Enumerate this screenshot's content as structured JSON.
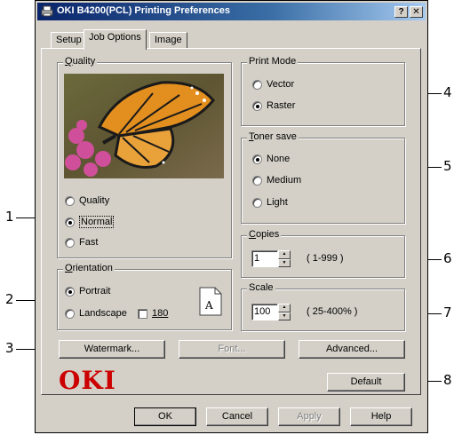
{
  "window": {
    "title": "OKI B4200(PCL) Printing Preferences",
    "help_btn": "?",
    "close_btn": "✕"
  },
  "tabs": [
    {
      "label": "Setup",
      "active": false
    },
    {
      "label": "Job Options",
      "active": true
    },
    {
      "label": "Image",
      "active": false
    }
  ],
  "quality": {
    "group_label": "Quality",
    "options": [
      {
        "label": "Quality",
        "selected": false
      },
      {
        "label": "Normal",
        "selected": true
      },
      {
        "label": "Fast",
        "selected": false
      }
    ]
  },
  "orientation": {
    "group_label": "Orientation",
    "portrait": "Portrait",
    "landscape": "Landscape",
    "rotate_label": "180",
    "page_icon_letter": "A"
  },
  "print_mode": {
    "group_label": "Print Mode",
    "options": [
      {
        "label": "Vector",
        "selected": false
      },
      {
        "label": "Raster",
        "selected": true
      }
    ]
  },
  "toner_save": {
    "group_label": "Toner save",
    "options": [
      {
        "label": "None",
        "selected": true
      },
      {
        "label": "Medium",
        "selected": false
      },
      {
        "label": "Light",
        "selected": false
      }
    ]
  },
  "copies": {
    "group_label": "Copies",
    "value": "1",
    "range": "( 1-999 )"
  },
  "scale": {
    "group_label": "Scale",
    "value": "100",
    "range": "( 25-400% )"
  },
  "buttons": {
    "watermark": "Watermark...",
    "font": "Font...",
    "advanced": "Advanced...",
    "default": "Default",
    "ok": "OK",
    "cancel": "Cancel",
    "apply": "Apply",
    "help": "Help"
  },
  "brand": {
    "logo_text": "OKI",
    "logo_color": "#cc0000"
  },
  "callouts": [
    "1",
    "2",
    "3",
    "4",
    "5",
    "6",
    "7",
    "8"
  ]
}
